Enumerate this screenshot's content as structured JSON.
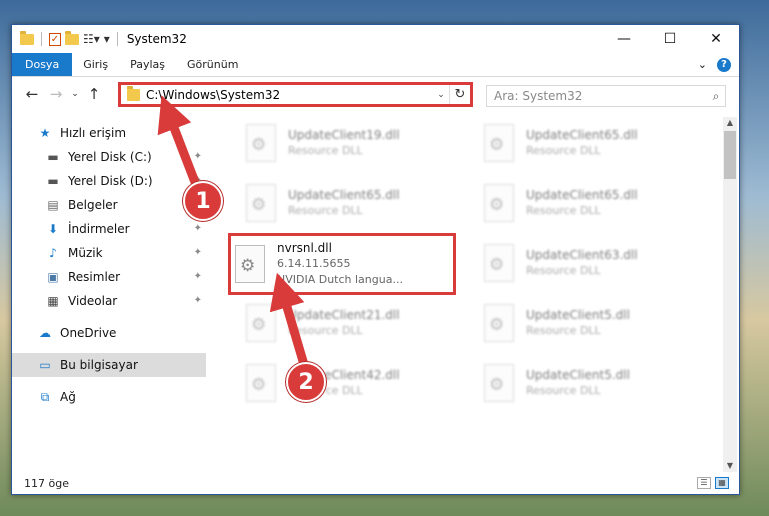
{
  "window": {
    "title": "System32",
    "caption": {
      "minimize": "—",
      "maximize": "☐",
      "close": "✕"
    }
  },
  "ribbon": {
    "tabs": [
      "Dosya",
      "Giriş",
      "Paylaş",
      "Görünüm"
    ],
    "collapse": "⌄",
    "help": "?"
  },
  "nav": {
    "back": "←",
    "forward": "→",
    "recent": "⌄",
    "up": "↑",
    "address": "C:\\Windows\\System32",
    "dropdown": "⌄",
    "refresh": "↻",
    "search_placeholder": "Ara: System32"
  },
  "sidebar": {
    "items": [
      {
        "label": "Hızlı erişim",
        "icon": "star-icon",
        "glyph": "★",
        "color": "#1979ca",
        "pinned": false
      },
      {
        "label": "Yerel Disk (C:)",
        "icon": "drive-icon",
        "glyph": "▬",
        "color": "#555",
        "pinned": true
      },
      {
        "label": "Yerel Disk (D:)",
        "icon": "drive-icon",
        "glyph": "▬",
        "color": "#555",
        "pinned": true
      },
      {
        "label": "Belgeler",
        "icon": "document-icon",
        "glyph": "▤",
        "color": "#666",
        "pinned": true
      },
      {
        "label": "İndirmeler",
        "icon": "download-icon",
        "glyph": "⬇",
        "color": "#1979ca",
        "pinned": true
      },
      {
        "label": "Müzik",
        "icon": "music-icon",
        "glyph": "♪",
        "color": "#1979ca",
        "pinned": true
      },
      {
        "label": "Resimler",
        "icon": "pictures-icon",
        "glyph": "▣",
        "color": "#4a7aa8",
        "pinned": true
      },
      {
        "label": "Videolar",
        "icon": "video-icon",
        "glyph": "▦",
        "color": "#444",
        "pinned": true
      },
      {
        "label": "OneDrive",
        "icon": "cloud-icon",
        "glyph": "☁",
        "color": "#1979ca",
        "pinned": false
      },
      {
        "label": "Bu bilgisayar",
        "icon": "computer-icon",
        "glyph": "▭",
        "color": "#1979ca",
        "pinned": false,
        "selected": true
      },
      {
        "label": "Ağ",
        "icon": "network-icon",
        "glyph": "⧉",
        "color": "#1979ca",
        "pinned": false
      }
    ],
    "pin_glyph": "📌"
  },
  "files": [
    {
      "name": "UpdateClient19.dll",
      "sub": "Resource DLL",
      "blurred": true
    },
    {
      "name": "UpdateClient65.dll",
      "sub": "Resource DLL",
      "blurred": true
    },
    {
      "name": "UpdateClient65.dll",
      "sub": "Resource DLL",
      "blurred": true
    },
    {
      "name": "UpdateClient65.dll",
      "sub": "Resource DLL",
      "blurred": true
    },
    {
      "name": "nvrsnl.dll",
      "sub": "6.14.11.5655",
      "sub2": "NVIDIA Dutch langua...",
      "blurred": false,
      "highlighted": true
    },
    {
      "name": "UpdateClient63.dll",
      "sub": "Resource DLL",
      "blurred": true
    },
    {
      "name": "UpdateClient21.dll",
      "sub": "Resource DLL",
      "blurred": true
    },
    {
      "name": "UpdateClient5.dll",
      "sub": "Resource DLL",
      "blurred": true
    },
    {
      "name": "UpdateClient42.dll",
      "sub": "Resource DLL",
      "blurred": true
    },
    {
      "name": "UpdateClient5.dll",
      "sub": "Resource DLL",
      "blurred": true
    }
  ],
  "status": {
    "count": "117 öge"
  },
  "annotations": {
    "step1": "1",
    "step2": "2",
    "color": "#d93b3b"
  }
}
